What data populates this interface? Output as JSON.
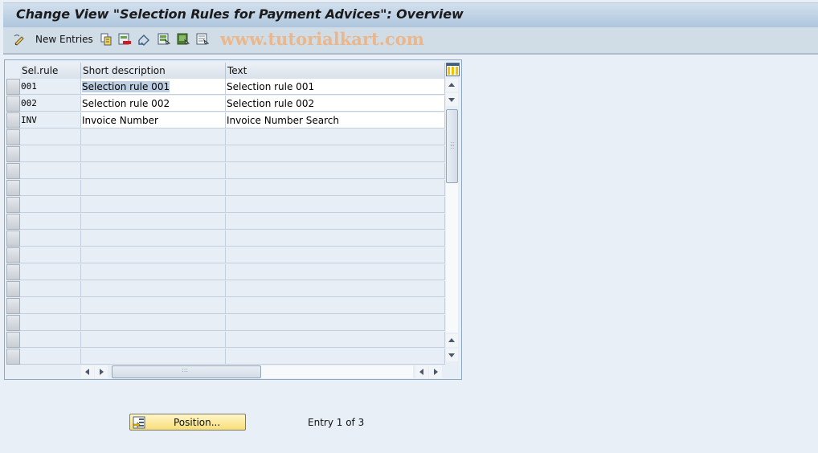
{
  "window": {
    "title": "Change View \"Selection Rules for Payment Advices\": Overview"
  },
  "toolbar": {
    "items": [
      {
        "icon": "edit-pencil-icon",
        "label": ""
      },
      {
        "icon": "new-entries",
        "label": "New Entries"
      },
      {
        "icon": "copy-icon",
        "label": ""
      },
      {
        "icon": "delete-icon",
        "label": ""
      },
      {
        "icon": "undo-icon",
        "label": ""
      },
      {
        "icon": "select-all-icon",
        "label": ""
      },
      {
        "icon": "select-block-icon",
        "label": ""
      },
      {
        "icon": "deselect-all-icon",
        "label": ""
      }
    ],
    "watermark": "www.tutorialkart.com"
  },
  "table": {
    "columns": [
      "Sel.rule",
      "Short description",
      "Text"
    ],
    "rows": [
      {
        "sel_rule": "001",
        "short_description": "Selection rule 001",
        "text": "Selection rule 001"
      },
      {
        "sel_rule": "002",
        "short_description": "Selection rule 002",
        "text": "Selection rule 002"
      },
      {
        "sel_rule": "INV",
        "short_description": "Invoice Number",
        "text": "Invoice Number Search"
      }
    ],
    "empty_rows": 14,
    "selected_cell": "Selection rule 001"
  },
  "footer": {
    "position_button": "Position...",
    "entry_info": "Entry 1 of 3"
  }
}
